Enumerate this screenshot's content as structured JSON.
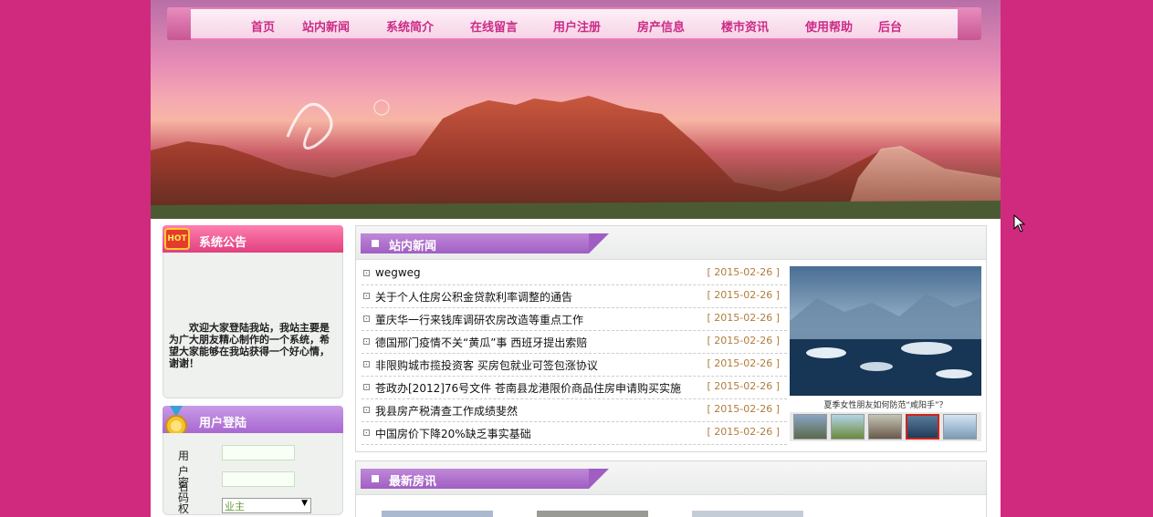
{
  "nav": {
    "items": [
      "首页",
      "站内新闻",
      "系统简介",
      "在线留言",
      "用户注册",
      "房产信息",
      "楼市资讯",
      "使用帮助",
      "后台"
    ]
  },
  "notice": {
    "title": "系统公告",
    "badge": "HOT",
    "text": "欢迎大家登陆我站，我站主要是为广大朋友精心制作的一个系统，希望大家能够在我站获得一个好心情，谢谢！"
  },
  "login": {
    "title": "用户登陆",
    "username_label": "用户名",
    "password_label": "密码",
    "role_label": "权限",
    "role_selected": "业主"
  },
  "news": {
    "title": "站内新闻",
    "items": [
      {
        "title": "wegweg",
        "date": "[ 2015-02-26 ]"
      },
      {
        "title": "关于个人住房公积金贷款利率调整的通告",
        "date": "[ 2015-02-26 ]"
      },
      {
        "title": "董庆华一行来钱库调研农房改造等重点工作",
        "date": "[ 2015-02-26 ]"
      },
      {
        "title": "德国邢门疫情不关“黄瓜”事 西班牙提出索赔",
        "date": "[ 2015-02-26 ]"
      },
      {
        "title": "非限购城市揽投资客 买房包就业可签包涨协议",
        "date": "[ 2015-02-26 ]"
      },
      {
        "title": "苍政办[2012]76号文件 苍南县龙港限价商品住房申请购买实施",
        "date": "[ 2015-02-26 ]"
      },
      {
        "title": "我县房产税清查工作成绩斐然",
        "date": "[ 2015-02-26 ]"
      },
      {
        "title": "中国房价下降20%缺乏事实基础",
        "date": "[ 2015-02-26 ]"
      }
    ],
    "photo_caption": "夏季女性朋友如何防范“咸阳手”？"
  },
  "houses": {
    "title": "最新房讯"
  },
  "colors": {
    "outer_bg": "#d02a7f",
    "nav_text": "#cc2b86",
    "date_text": "#b07c3c",
    "tab_purple": "#a05ec3",
    "notice_pink": "#e1407f"
  }
}
